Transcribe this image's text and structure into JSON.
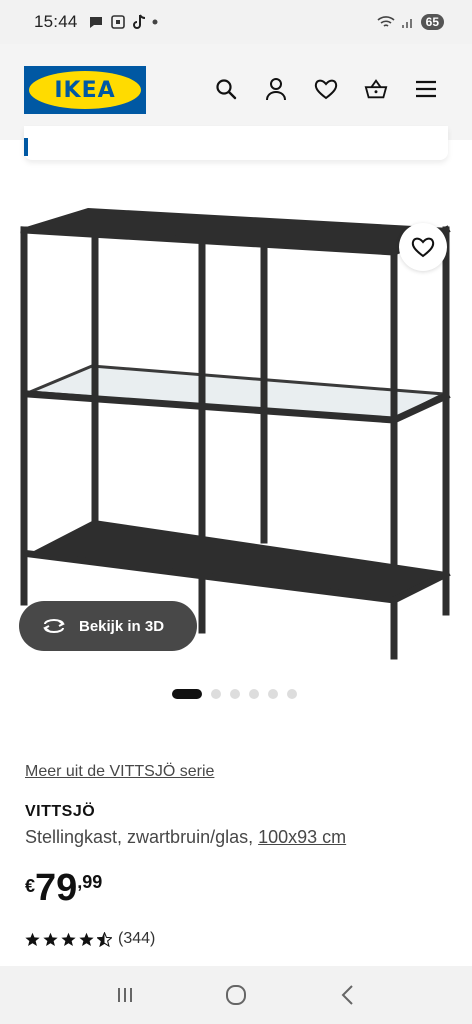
{
  "status_bar": {
    "time": "15:44",
    "battery": "65"
  },
  "header": {
    "logo_text": "IKEA",
    "icons": [
      "search-icon",
      "account-icon",
      "heart-icon",
      "basket-icon",
      "menu-icon"
    ]
  },
  "gallery": {
    "view3d_label": "Bekijk in 3D",
    "slide_count": 6,
    "active_slide": 1
  },
  "product": {
    "series_link": "Meer uit de VITTSJÖ serie",
    "name": "VITTSJÖ",
    "description_prefix": "Stellingkast, zwartbruin/glas, ",
    "dimensions": "100x93 cm",
    "price_currency": "€",
    "price_integer": "79",
    "price_decimal": ",99",
    "rating_value": 4.5,
    "rating_count": "(344)"
  },
  "colors": {
    "ikea_blue": "#0058a3",
    "ikea_yellow": "#ffdb00",
    "shelf": "#2e2e2e"
  }
}
